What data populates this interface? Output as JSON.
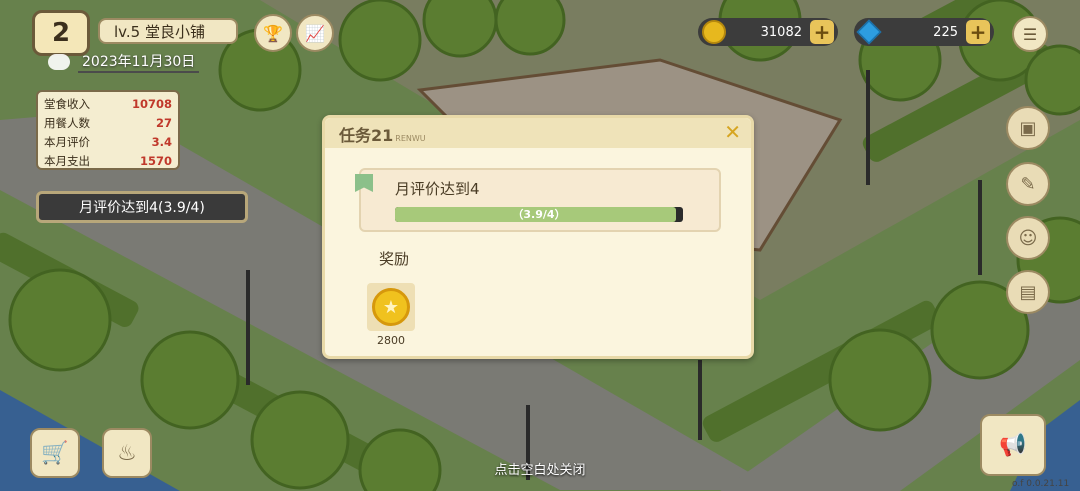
{
  "hud": {
    "level_badge": "2",
    "shop_name": "lv.5 堂良小铺",
    "date": "2023年11月30日",
    "coins": "31082",
    "gems": "225",
    "plus": "+"
  },
  "stats": [
    {
      "label": "堂食收入",
      "value": "10708"
    },
    {
      "label": "用餐人数",
      "value": "27"
    },
    {
      "label": "本月评价",
      "value": "3.4"
    },
    {
      "label": "本月支出",
      "value": "1570"
    }
  ],
  "current_task_tag": "月评价达到4(3.9/4)",
  "dialog": {
    "title": "任务21",
    "title_sub": "RENWU",
    "close": "✕",
    "task_text": "月评价达到4",
    "progress_text": "（3.9/4）",
    "progress_fraction": 0.975,
    "reward_label": "奖励",
    "reward_amount": "2800"
  },
  "hint": "点击空白处关闭",
  "version": "o.f 0.0.21.11",
  "colors": {
    "accent": "#d6a521",
    "progress": "#a7c97a",
    "grass": "#8fb36a",
    "path": "#a9a9a1"
  }
}
